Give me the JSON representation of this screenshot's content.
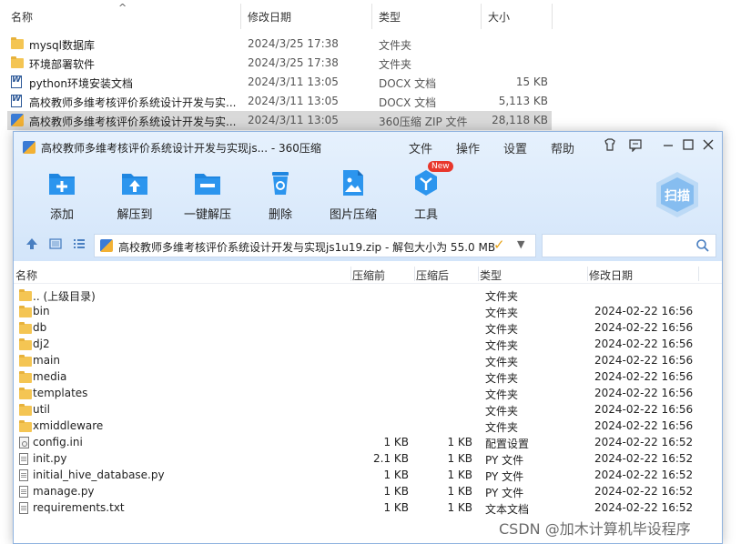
{
  "explorer": {
    "columns": {
      "name": "名称",
      "date": "修改日期",
      "type": "类型",
      "size": "大小"
    },
    "rows": [
      {
        "icon": "folder-icon",
        "name": "mysql数据库",
        "date": "2024/3/25 17:38",
        "type": "文件夹",
        "size": "",
        "selected": false
      },
      {
        "icon": "folder-icon",
        "name": "环境部署软件",
        "date": "2024/3/25 17:38",
        "type": "文件夹",
        "size": "",
        "selected": false
      },
      {
        "icon": "word-doc-icon",
        "name": "python环境安装文档",
        "date": "2024/3/11 13:05",
        "type": "DOCX 文档",
        "size": "15 KB",
        "selected": false
      },
      {
        "icon": "word-doc-icon",
        "name": "高校教师多维考核评价系统设计开发与实...",
        "date": "2024/3/11 13:05",
        "type": "DOCX 文档",
        "size": "5,113 KB",
        "selected": false
      },
      {
        "icon": "zip-archive-icon",
        "name": "高校教师多维考核评价系统设计开发与实...",
        "date": "2024/3/11 13:05",
        "type": "360压缩 ZIP 文件",
        "size": "28,118 KB",
        "selected": true
      }
    ]
  },
  "archiver": {
    "title": "高校教师多维考核评价系统设计开发与实现js... - 360压缩",
    "menu": [
      "文件",
      "操作",
      "设置",
      "帮助"
    ],
    "toolbar": [
      {
        "label": "添加",
        "icon": "add-icon"
      },
      {
        "label": "解压到",
        "icon": "extract-to-icon"
      },
      {
        "label": "一键解压",
        "icon": "one-click-extract-icon"
      },
      {
        "label": "删除",
        "icon": "delete-icon"
      },
      {
        "label": "图片压缩",
        "icon": "image-compress-icon"
      },
      {
        "label": "工具",
        "icon": "tools-icon"
      }
    ],
    "new_badge": "New",
    "scan_label": "扫描",
    "path": "高校教师多维考核评价系统设计开发与实现js1u19.zip - 解包大小为 55.0 MB",
    "search_placeholder": "",
    "columns": {
      "name": "名称",
      "before": "压缩前",
      "after": "压缩后",
      "type": "类型",
      "date": "修改日期"
    },
    "files": [
      {
        "icon": "folder-icon",
        "name": ".. (上级目录)",
        "before": "",
        "after": "",
        "type": "文件夹",
        "date": ""
      },
      {
        "icon": "folder-icon",
        "name": "bin",
        "before": "",
        "after": "",
        "type": "文件夹",
        "date": "2024-02-22 16:56"
      },
      {
        "icon": "folder-icon",
        "name": "db",
        "before": "",
        "after": "",
        "type": "文件夹",
        "date": "2024-02-22 16:56"
      },
      {
        "icon": "folder-icon",
        "name": "dj2",
        "before": "",
        "after": "",
        "type": "文件夹",
        "date": "2024-02-22 16:56"
      },
      {
        "icon": "folder-icon",
        "name": "main",
        "before": "",
        "after": "",
        "type": "文件夹",
        "date": "2024-02-22 16:56"
      },
      {
        "icon": "folder-icon",
        "name": "media",
        "before": "",
        "after": "",
        "type": "文件夹",
        "date": "2024-02-22 16:56"
      },
      {
        "icon": "folder-icon",
        "name": "templates",
        "before": "",
        "after": "",
        "type": "文件夹",
        "date": "2024-02-22 16:56"
      },
      {
        "icon": "folder-icon",
        "name": "util",
        "before": "",
        "after": "",
        "type": "文件夹",
        "date": "2024-02-22 16:56"
      },
      {
        "icon": "folder-icon",
        "name": "xmiddleware",
        "before": "",
        "after": "",
        "type": "文件夹",
        "date": "2024-02-22 16:56"
      },
      {
        "icon": "config-file-icon",
        "name": "config.ini",
        "before": "1 KB",
        "after": "1 KB",
        "type": "配置设置",
        "date": "2024-02-22 16:52"
      },
      {
        "icon": "file-icon",
        "name": "init.py",
        "before": "2.1 KB",
        "after": "1 KB",
        "type": "PY 文件",
        "date": "2024-02-22 16:52"
      },
      {
        "icon": "file-icon",
        "name": "initial_hive_database.py",
        "before": "1 KB",
        "after": "1 KB",
        "type": "PY 文件",
        "date": "2024-02-22 16:52"
      },
      {
        "icon": "file-icon",
        "name": "manage.py",
        "before": "1 KB",
        "after": "1 KB",
        "type": "PY 文件",
        "date": "2024-02-22 16:52"
      },
      {
        "icon": "file-icon",
        "name": "requirements.txt",
        "before": "1 KB",
        "after": "1 KB",
        "type": "文本文档",
        "date": "2024-02-22 16:52"
      }
    ]
  },
  "watermark": "CSDN @加木计算机毕设程序"
}
